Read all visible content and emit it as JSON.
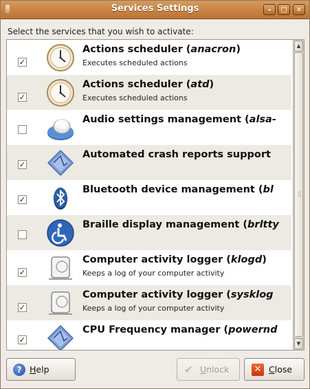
{
  "window": {
    "title": "Services Settings",
    "controls": {
      "minimize": "–",
      "maximize": "□",
      "close": "✕"
    }
  },
  "prompt": "Select the services that you wish to activate:",
  "services": [
    {
      "name": "Actions scheduler (",
      "name_italic": "anacron",
      "name_tail": ")",
      "desc": "Executes scheduled actions",
      "checked": true,
      "icon": "clock-icon"
    },
    {
      "name": "Actions scheduler (",
      "name_italic": "atd",
      "name_tail": ")",
      "desc": "Executes scheduled actions",
      "checked": true,
      "icon": "clock-icon"
    },
    {
      "name": "Audio settings management (",
      "name_italic": "alsa-",
      "name_tail": "",
      "desc": "",
      "checked": false,
      "icon": "audio-knob-icon"
    },
    {
      "name": "Automated crash reports support",
      "name_italic": "",
      "name_tail": "",
      "desc": "",
      "checked": true,
      "icon": "crash-report-diamond-icon"
    },
    {
      "name": "Bluetooth device management (",
      "name_italic": "bl",
      "name_tail": "",
      "desc": "",
      "checked": true,
      "icon": "bluetooth-icon"
    },
    {
      "name": "Braille display management (",
      "name_italic": "brltty",
      "name_tail": "",
      "desc": "",
      "checked": false,
      "icon": "accessibility-icon"
    },
    {
      "name": "Computer activity logger (",
      "name_italic": "klogd",
      "name_tail": ")",
      "desc": "Keeps a log of your computer activity",
      "checked": true,
      "icon": "log-scroll-icon"
    },
    {
      "name": "Computer activity logger (",
      "name_italic": "sysklog",
      "name_tail": "",
      "desc": "Keeps a log of your computer activity",
      "checked": true,
      "icon": "log-scroll-icon"
    },
    {
      "name": "CPU Frequency manager (",
      "name_italic": "powernd",
      "name_tail": "",
      "desc": "",
      "checked": true,
      "icon": "cpu-frequency-icon"
    }
  ],
  "buttons": {
    "help": {
      "pre": "",
      "ul": "H",
      "post": "elp"
    },
    "unlock": {
      "pre": "",
      "ul": "U",
      "post": "nlock"
    },
    "close": {
      "pre": "",
      "ul": "C",
      "post": "lose"
    }
  },
  "colors": {
    "titlebar": "#c98545",
    "row_alt": "#ede9e3",
    "close_icon": "#d9481b",
    "help_icon": "#2f5fb8"
  }
}
